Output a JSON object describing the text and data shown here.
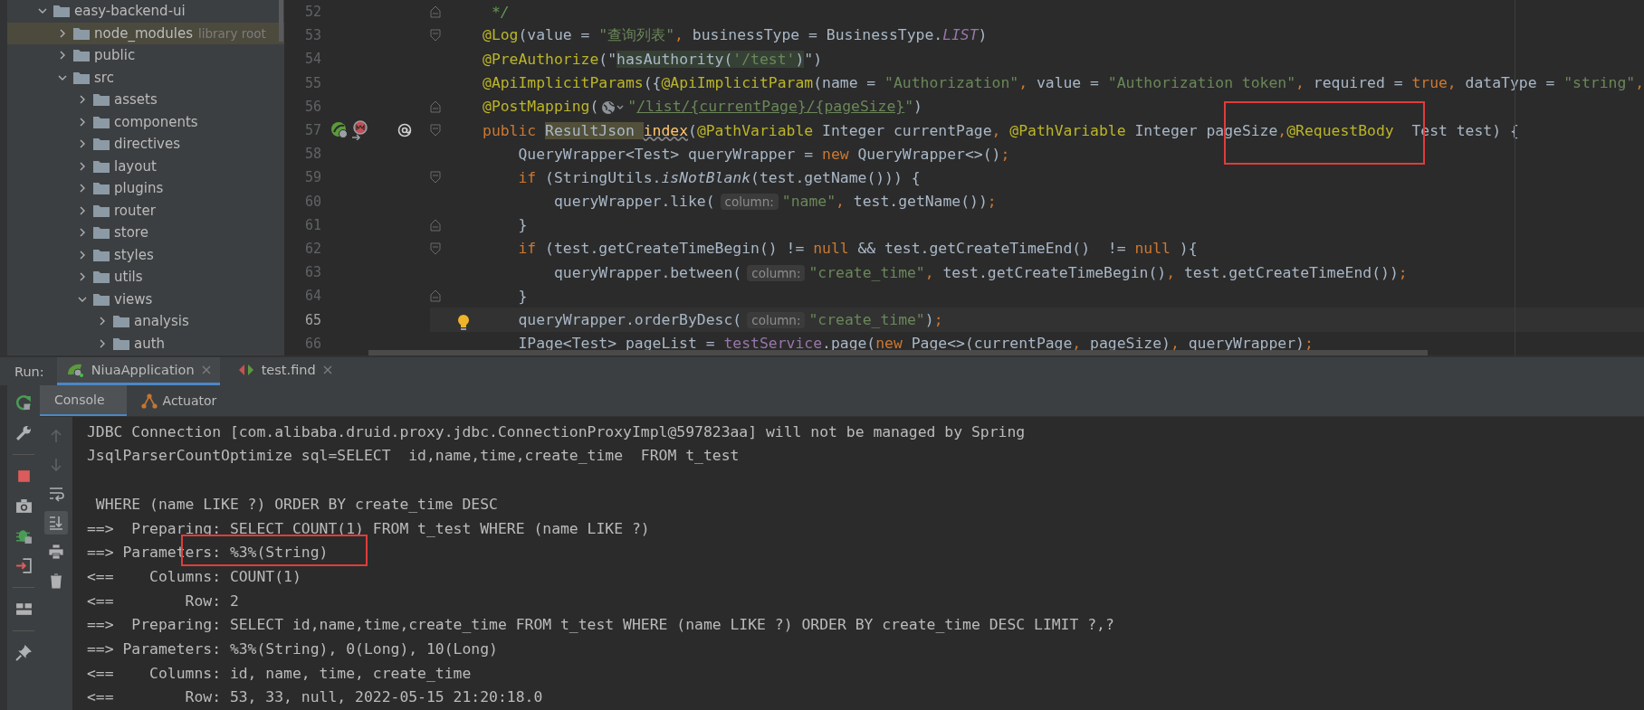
{
  "project_tree": [
    {
      "name": "easy-backend-ui",
      "expanded": true,
      "highlighted": false,
      "children": [
        {
          "name": "node_modules",
          "hint": "library root",
          "expanded": false,
          "highlighted": true
        },
        {
          "name": "public",
          "expanded": false,
          "highlighted": false
        },
        {
          "name": "src",
          "expanded": true,
          "highlighted": false,
          "children": [
            {
              "name": "assets",
              "expanded": false,
              "highlighted": false
            },
            {
              "name": "components",
              "expanded": false,
              "highlighted": false
            },
            {
              "name": "directives",
              "expanded": false,
              "highlighted": false
            },
            {
              "name": "layout",
              "expanded": false,
              "highlighted": false
            },
            {
              "name": "plugins",
              "expanded": false,
              "highlighted": false
            },
            {
              "name": "router",
              "expanded": false,
              "highlighted": false
            },
            {
              "name": "store",
              "expanded": false,
              "highlighted": false
            },
            {
              "name": "styles",
              "expanded": false,
              "highlighted": false
            },
            {
              "name": "utils",
              "expanded": false,
              "highlighted": false
            },
            {
              "name": "views",
              "expanded": true,
              "highlighted": false,
              "children": [
                {
                  "name": "analysis",
                  "expanded": false,
                  "highlighted": false
                },
                {
                  "name": "auth",
                  "expanded": false,
                  "highlighted": false
                }
              ]
            }
          ]
        }
      ]
    }
  ],
  "editor": {
    "annotation_box": true,
    "lines": [
      {
        "number": "52",
        "current": false,
        "bulb": false,
        "fold_marker": {
          "kind": "end"
        },
        "tokens": [
          {
            "kind": "comment",
            "text": " */"
          }
        ]
      },
      {
        "number": "53",
        "current": false,
        "bulb": false,
        "fold_marker": {
          "kind": "start"
        },
        "tokens": [
          {
            "kind": "anno",
            "text": "@Log"
          },
          {
            "kind": "plain",
            "text": "(value = "
          },
          {
            "kind": "str",
            "text": "\"查询列表\""
          },
          {
            "kind": "kw",
            "text": ", "
          },
          {
            "kind": "plain",
            "text": "businessType = BusinessType."
          },
          {
            "kind": "static",
            "text": "LIST"
          },
          {
            "kind": "plain",
            "text": ")"
          }
        ]
      },
      {
        "number": "54",
        "current": false,
        "bulb": false,
        "tokens": [
          {
            "kind": "anno",
            "text": "@PreAuthorize"
          },
          {
            "kind": "plain",
            "text": "(\""
          },
          {
            "kind": "inj",
            "text": "hasAuthority("
          },
          {
            "kind": "injstr",
            "text": "'/test'"
          },
          {
            "kind": "inj",
            "text": ")"
          },
          {
            "kind": "plain",
            "text": "\")"
          }
        ]
      },
      {
        "number": "55",
        "current": false,
        "bulb": false,
        "tokens": [
          {
            "kind": "anno",
            "text": "@ApiImplicitParams"
          },
          {
            "kind": "plain",
            "text": "({"
          },
          {
            "kind": "anno",
            "text": "@ApiImplicitParam"
          },
          {
            "kind": "plain",
            "text": "(name = "
          },
          {
            "kind": "str",
            "text": "\"Authorization\""
          },
          {
            "kind": "kw",
            "text": ", "
          },
          {
            "kind": "plain",
            "text": "value = "
          },
          {
            "kind": "str",
            "text": "\"Authorization token\""
          },
          {
            "kind": "kw",
            "text": ", "
          },
          {
            "kind": "plain",
            "text": "required = "
          },
          {
            "kind": "kw",
            "text": "true, "
          },
          {
            "kind": "plain",
            "text": "dataType = "
          },
          {
            "kind": "str",
            "text": "\"string\""
          },
          {
            "kind": "kw",
            "text": ","
          }
        ]
      },
      {
        "number": "56",
        "current": false,
        "bulb": false,
        "fold_marker": {
          "kind": "end"
        },
        "tokens": [
          {
            "kind": "anno",
            "text": "@PostMapping"
          },
          {
            "kind": "plain",
            "text": "(",
            "globe_after": true
          },
          {
            "kind": "str",
            "text": "\""
          },
          {
            "kind": "url",
            "text": "/list/{currentPage}/{pageSize}"
          },
          {
            "kind": "str",
            "text": "\""
          },
          {
            "kind": "plain",
            "text": ")"
          }
        ]
      },
      {
        "number": "57",
        "current": false,
        "bulb": false,
        "fold_marker": {
          "kind": "start"
        },
        "gutter_icons": [
          {
            "kind": "spring-bean"
          },
          {
            "kind": "mybatis"
          },
          {
            "kind": "implementation"
          }
        ],
        "tokens": [
          {
            "kind": "kw",
            "text": "public "
          },
          {
            "kind": "usage",
            "text": "ResultJson "
          },
          {
            "kind": "method",
            "text": "index"
          },
          {
            "kind": "plain",
            "text": "("
          },
          {
            "kind": "anno",
            "text": "@PathVariable"
          },
          {
            "kind": "plain",
            "text": " Integer currentPage"
          },
          {
            "kind": "kw",
            "text": ", "
          },
          {
            "kind": "anno",
            "text": "@PathVariable"
          },
          {
            "kind": "plain",
            "text": " Integer pageSize"
          },
          {
            "kind": "kw",
            "text": ","
          },
          {
            "kind": "anno",
            "text": "@RequestBody"
          },
          {
            "kind": "plain",
            "text": "  Test test) {"
          }
        ]
      },
      {
        "number": "58",
        "current": false,
        "bulb": false,
        "tokens": [
          {
            "kind": "plain",
            "text": "    QueryWrapper<Test> queryWrapper = "
          },
          {
            "kind": "kw",
            "text": "new "
          },
          {
            "kind": "plain",
            "text": "QueryWrapper<>()"
          },
          {
            "kind": "kw",
            "text": ";"
          }
        ]
      },
      {
        "number": "59",
        "current": false,
        "bulb": false,
        "fold_marker": {
          "kind": "start"
        },
        "tokens": [
          {
            "kind": "kw",
            "text": "    if "
          },
          {
            "kind": "plain",
            "text": "(StringUtils."
          },
          {
            "kind": "italic",
            "text": "isNotBlank"
          },
          {
            "kind": "plain",
            "text": "(test.getName())) {"
          }
        ]
      },
      {
        "number": "60",
        "current": false,
        "bulb": false,
        "tokens": [
          {
            "kind": "plain",
            "text": "        queryWrapper.like("
          },
          {
            "kind": "hint",
            "text": "column:"
          },
          {
            "kind": "str",
            "text": "\"name\""
          },
          {
            "kind": "kw",
            "text": ", "
          },
          {
            "kind": "plain",
            "text": "test.getName())"
          },
          {
            "kind": "kw",
            "text": ";"
          }
        ]
      },
      {
        "number": "61",
        "current": false,
        "bulb": false,
        "fold_marker": {
          "kind": "end"
        },
        "tokens": [
          {
            "kind": "plain",
            "text": "    }"
          }
        ]
      },
      {
        "number": "62",
        "current": false,
        "bulb": false,
        "fold_marker": {
          "kind": "start"
        },
        "tokens": [
          {
            "kind": "kw",
            "text": "    if "
          },
          {
            "kind": "plain",
            "text": "(test.getCreateTimeBegin() != "
          },
          {
            "kind": "kw",
            "text": "null "
          },
          {
            "kind": "plain",
            "text": "&& test.getCreateTimeEnd()  != "
          },
          {
            "kind": "kw",
            "text": "null "
          },
          {
            "kind": "plain",
            "text": "){"
          }
        ]
      },
      {
        "number": "63",
        "current": false,
        "bulb": false,
        "tokens": [
          {
            "kind": "plain",
            "text": "        queryWrapper.between("
          },
          {
            "kind": "hint",
            "text": "column:"
          },
          {
            "kind": "str",
            "text": "\"create_time\""
          },
          {
            "kind": "kw",
            "text": ", "
          },
          {
            "kind": "plain",
            "text": "test.getCreateTimeBegin()"
          },
          {
            "kind": "kw",
            "text": ", "
          },
          {
            "kind": "plain",
            "text": "test.getCreateTimeEnd())"
          },
          {
            "kind": "kw",
            "text": ";"
          }
        ]
      },
      {
        "number": "64",
        "current": false,
        "bulb": false,
        "fold_marker": {
          "kind": "end"
        },
        "tokens": [
          {
            "kind": "plain",
            "text": "    }"
          }
        ]
      },
      {
        "number": "65",
        "current": true,
        "bulb": true,
        "tokens": [
          {
            "kind": "plain",
            "text": "    queryWrapper.orderByDesc("
          },
          {
            "kind": "hint",
            "text": "column:"
          },
          {
            "kind": "str",
            "text": "\"create_time\""
          },
          {
            "kind": "plain",
            "text": ")"
          },
          {
            "kind": "kw",
            "text": ";"
          }
        ]
      },
      {
        "number": "66",
        "current": false,
        "bulb": false,
        "tokens": [
          {
            "kind": "plain",
            "text": "    IPage<Test> pageList = "
          },
          {
            "kind": "field",
            "text": "testService"
          },
          {
            "kind": "plain",
            "text": ".page("
          },
          {
            "kind": "kw",
            "text": "new "
          },
          {
            "kind": "plain",
            "text": "Page<>(currentPage"
          },
          {
            "kind": "kw",
            "text": ", "
          },
          {
            "kind": "plain",
            "text": "pageSize)"
          },
          {
            "kind": "kw",
            "text": ", "
          },
          {
            "kind": "plain",
            "text": "queryWrapper)"
          },
          {
            "kind": "kw",
            "text": ";"
          }
        ]
      }
    ]
  },
  "run_panel": {
    "annotation_box": true,
    "label": "Run:",
    "tabs": [
      {
        "kind": "app",
        "label": "NiuaApplication",
        "selected": true,
        "closable": true
      },
      {
        "kind": "request",
        "label": "test.find",
        "selected": false,
        "closable": true
      }
    ],
    "sub_tabs": [
      {
        "kind": "console",
        "label": "Console",
        "selected": true
      },
      {
        "kind": "actuator",
        "label": "Actuator",
        "selected": false
      }
    ],
    "toolbar": [
      {
        "kind": "rerun"
      },
      {
        "kind": "wrench"
      },
      {
        "kind": "separator"
      },
      {
        "kind": "stop"
      },
      {
        "kind": "camera"
      },
      {
        "kind": "debug"
      },
      {
        "kind": "exit"
      },
      {
        "kind": "separator"
      },
      {
        "kind": "layout"
      },
      {
        "kind": "separator"
      },
      {
        "kind": "pin"
      }
    ],
    "console_toolbar": [
      {
        "kind": "up",
        "on": false
      },
      {
        "kind": "down",
        "on": false
      },
      {
        "kind": "wrap",
        "on": false
      },
      {
        "kind": "scroll-end",
        "on": true
      },
      {
        "kind": "print",
        "on": false
      },
      {
        "kind": "trash",
        "on": false
      }
    ],
    "console": [
      {
        "kind": "text",
        "text": "JDBC Connection [com.alibaba.druid.proxy.jdbc.ConnectionProxyImpl@597823aa] will not be managed by Spring"
      },
      {
        "kind": "text",
        "text": "JsqlParserCountOptimize sql=SELECT  id,name,time,create_time  FROM t_test"
      },
      {
        "kind": "blank"
      },
      {
        "kind": "text",
        "text": " WHERE (name LIKE ?) ORDER BY create_time DESC"
      },
      {
        "kind": "text",
        "text": "==>  Preparing: SELECT COUNT(1) FROM t_test WHERE (name LIKE ?)"
      },
      {
        "kind": "text",
        "text": "==> Parameters: %3%(String)"
      },
      {
        "kind": "text",
        "text": "<==    Columns: COUNT(1)"
      },
      {
        "kind": "text",
        "text": "<==        Row: 2"
      },
      {
        "kind": "text",
        "text": "==>  Preparing: SELECT id,name,time,create_time FROM t_test WHERE (name LIKE ?) ORDER BY create_time DESC LIMIT ?,?"
      },
      {
        "kind": "text",
        "text": "==> Parameters: %3%(String), 0(Long), 10(Long)"
      },
      {
        "kind": "text",
        "text": "<==    Columns: id, name, time, create_time"
      },
      {
        "kind": "text",
        "text": "<==        Row: 53, 33, null, 2022-05-15 21:20:18.0"
      }
    ]
  }
}
